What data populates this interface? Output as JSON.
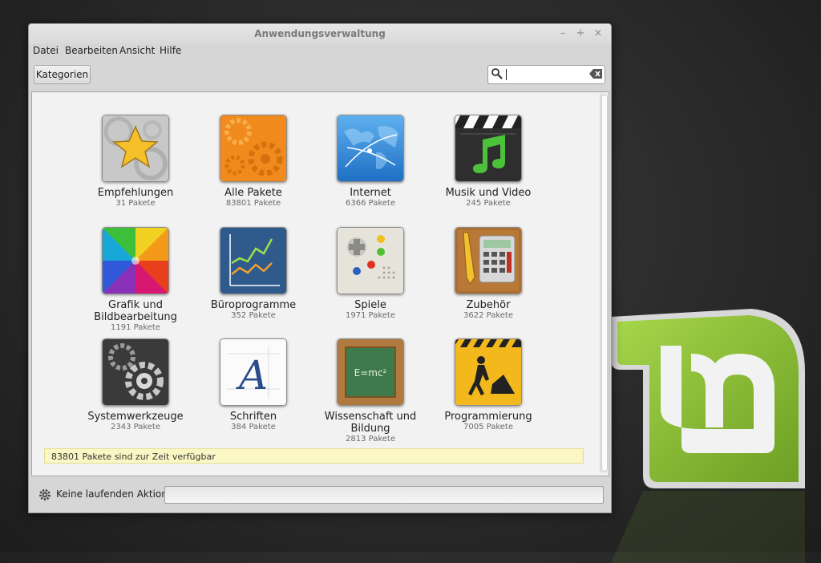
{
  "window": {
    "title": "Anwendungsverwaltung",
    "minimize": "–",
    "maximize": "+",
    "close": "×"
  },
  "menu": [
    "Datei",
    "Bearbeiten",
    "Ansicht",
    "Hilfe"
  ],
  "toolbar": {
    "categories_label": "Kategorien",
    "search_value": ""
  },
  "categories": [
    {
      "name": "Empfehlungen",
      "count": "31 Pakete",
      "icon": "star-gears-icon"
    },
    {
      "name": "Alle Pakete",
      "count": "83801 Pakete",
      "icon": "orange-gears-icon"
    },
    {
      "name": "Internet",
      "count": "6366 Pakete",
      "icon": "globe-network-icon"
    },
    {
      "name": "Musik und Video",
      "count": "245 Pakete",
      "icon": "clapper-music-icon"
    },
    {
      "name": "Grafik und Bildbearbeitung",
      "count": "1191 Pakete",
      "icon": "color-wheel-icon"
    },
    {
      "name": "Büroprogramme",
      "count": "352 Pakete",
      "icon": "line-chart-icon"
    },
    {
      "name": "Spiele",
      "count": "1971 Pakete",
      "icon": "gamepad-icon"
    },
    {
      "name": "Zubehör",
      "count": "3622 Pakete",
      "icon": "calculator-icon"
    },
    {
      "name": "Systemwerkzeuge",
      "count": "2343 Pakete",
      "icon": "system-gears-icon"
    },
    {
      "name": "Schriften",
      "count": "384 Pakete",
      "icon": "font-letter-icon"
    },
    {
      "name": "Wissenschaft und Bildung",
      "count": "2813 Pakete",
      "icon": "chalkboard-icon"
    },
    {
      "name": "Programmierung",
      "count": "7005 Pakete",
      "icon": "construction-sign-icon"
    }
  ],
  "notice": "83801 Pakete sind zur Zeit verfügbar",
  "status": {
    "text": "Keine laufenden Aktionen"
  },
  "colors": {
    "mint_green": "#87b93a",
    "notice_bg": "#fbf7c4"
  }
}
